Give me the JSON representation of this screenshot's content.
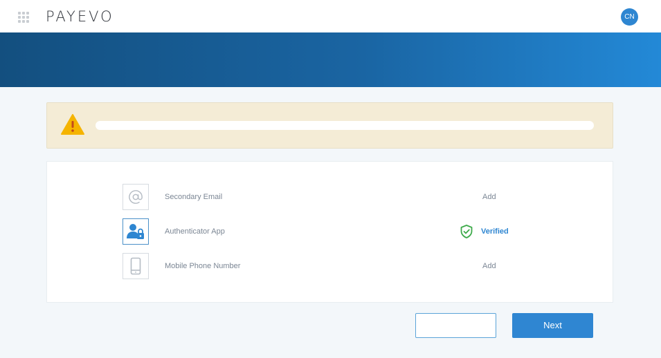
{
  "header": {
    "logo": "PAYEVO",
    "avatar_initials": "CN"
  },
  "methods": [
    {
      "label": "Secondary Email",
      "status": "Add",
      "icon": "at-sign-icon"
    },
    {
      "label": "Authenticator App",
      "status": "Verified",
      "icon": "user-lock-icon"
    },
    {
      "label": "Mobile Phone Number",
      "status": "Add",
      "icon": "mobile-phone-icon"
    }
  ],
  "buttons": {
    "back_label": "",
    "next_label": "Next"
  },
  "colors": {
    "accent": "#2f86d2",
    "banner_start": "#134f7f",
    "banner_end": "#2389d7",
    "warning_bg": "#f4ecd6",
    "warning_icon": "#f5b400",
    "verified_green": "#3daa4a"
  }
}
